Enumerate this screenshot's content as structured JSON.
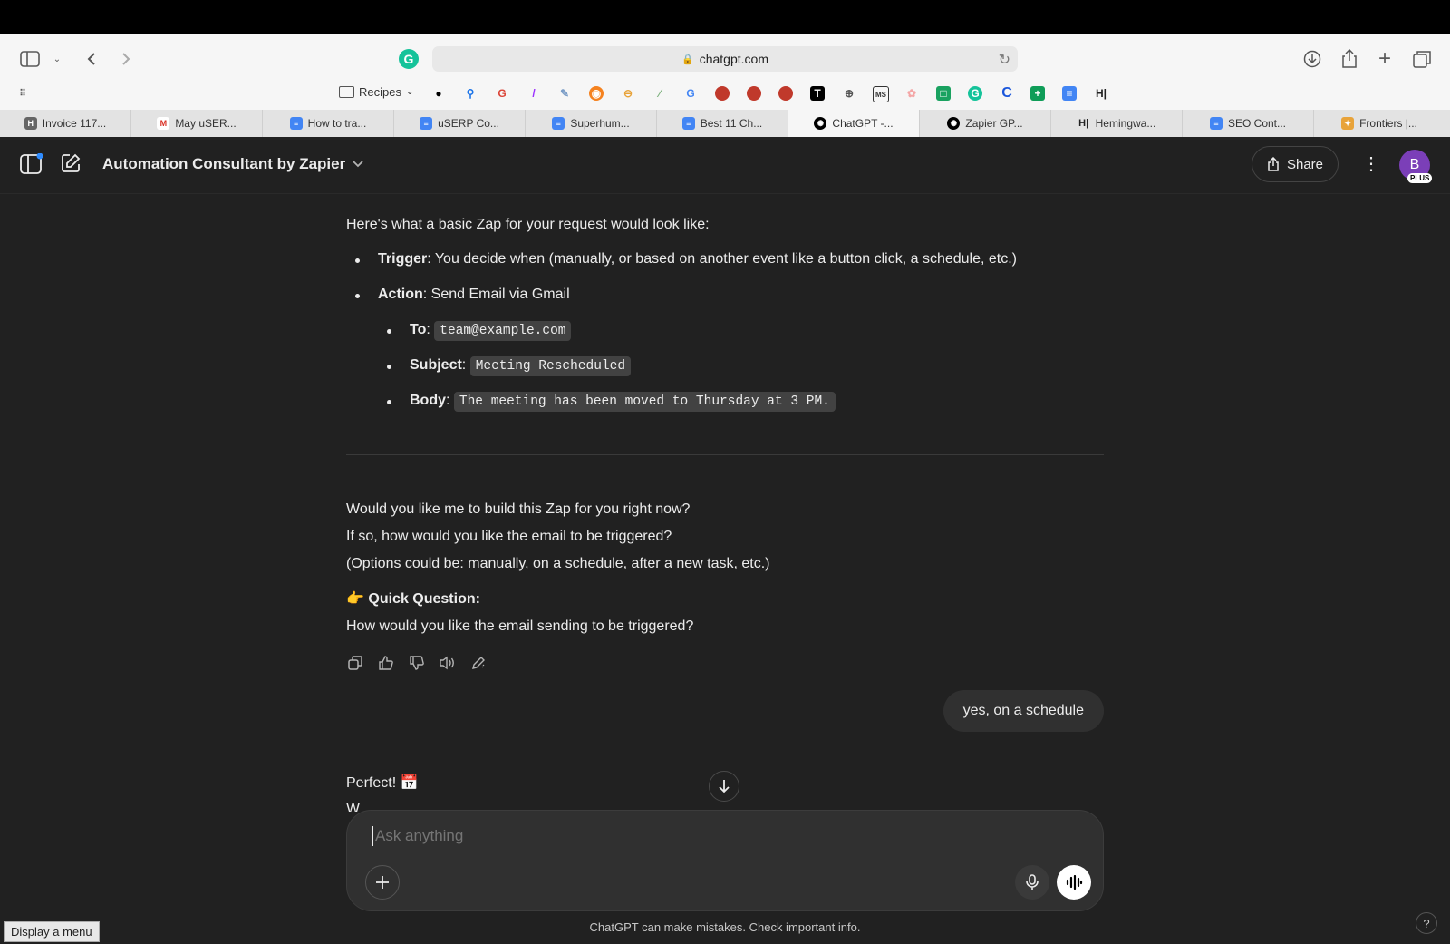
{
  "browser": {
    "url": "chatgpt.com",
    "bookmarks_folder": "Recipes",
    "tabs": [
      {
        "label": "Invoice 117...",
        "icon": "H"
      },
      {
        "label": "May uSER...",
        "icon": "M"
      },
      {
        "label": "How to tra...",
        "icon": "doc"
      },
      {
        "label": "uSERP Co...",
        "icon": "doc"
      },
      {
        "label": "Superhum...",
        "icon": "doc"
      },
      {
        "label": "Best 11 Ch...",
        "icon": "doc"
      },
      {
        "label": "ChatGPT -...",
        "icon": "openai",
        "active": true
      },
      {
        "label": "Zapier GP...",
        "icon": "openai"
      },
      {
        "label": "Hemingwa...",
        "icon": "H|"
      },
      {
        "label": "SEO Cont...",
        "icon": "doc"
      },
      {
        "label": "Frontiers |...",
        "icon": "frontiers"
      }
    ]
  },
  "app": {
    "model_name": "Automation Consultant by Zapier",
    "share_label": "Share",
    "avatar_letter": "B",
    "plan_badge": "PLUS"
  },
  "message": {
    "intro": "Here's what a basic Zap for your request would look like:",
    "trigger_label": "Trigger",
    "trigger_text": ": You decide when (manually, or based on another event like a button click, a schedule, etc.)",
    "action_label": "Action",
    "action_text": ": Send Email via Gmail",
    "to_label": "To",
    "to_value": "team@example.com",
    "subject_label": "Subject",
    "subject_value": "Meeting Rescheduled",
    "body_label": "Body",
    "body_value": "The meeting has been moved to Thursday at 3 PM.",
    "q1": "Would you like me to build this Zap for you right now?",
    "q2": "If so, how would you like the email to be triggered?",
    "q3": "(Options could be: manually, on a schedule, after a new task, etc.)",
    "quick_emoji": "👉",
    "quick_label": "Quick Question:",
    "quick_text": "How would you like the email sending to be triggered?"
  },
  "user_message": "yes, on a schedule",
  "reply": {
    "text": "Perfect! 📅",
    "partial": "W"
  },
  "composer": {
    "placeholder": "Ask anything"
  },
  "footer_note": "ChatGPT can make mistakes. Check important info.",
  "tooltip": "Display a menu",
  "help_label": "?"
}
